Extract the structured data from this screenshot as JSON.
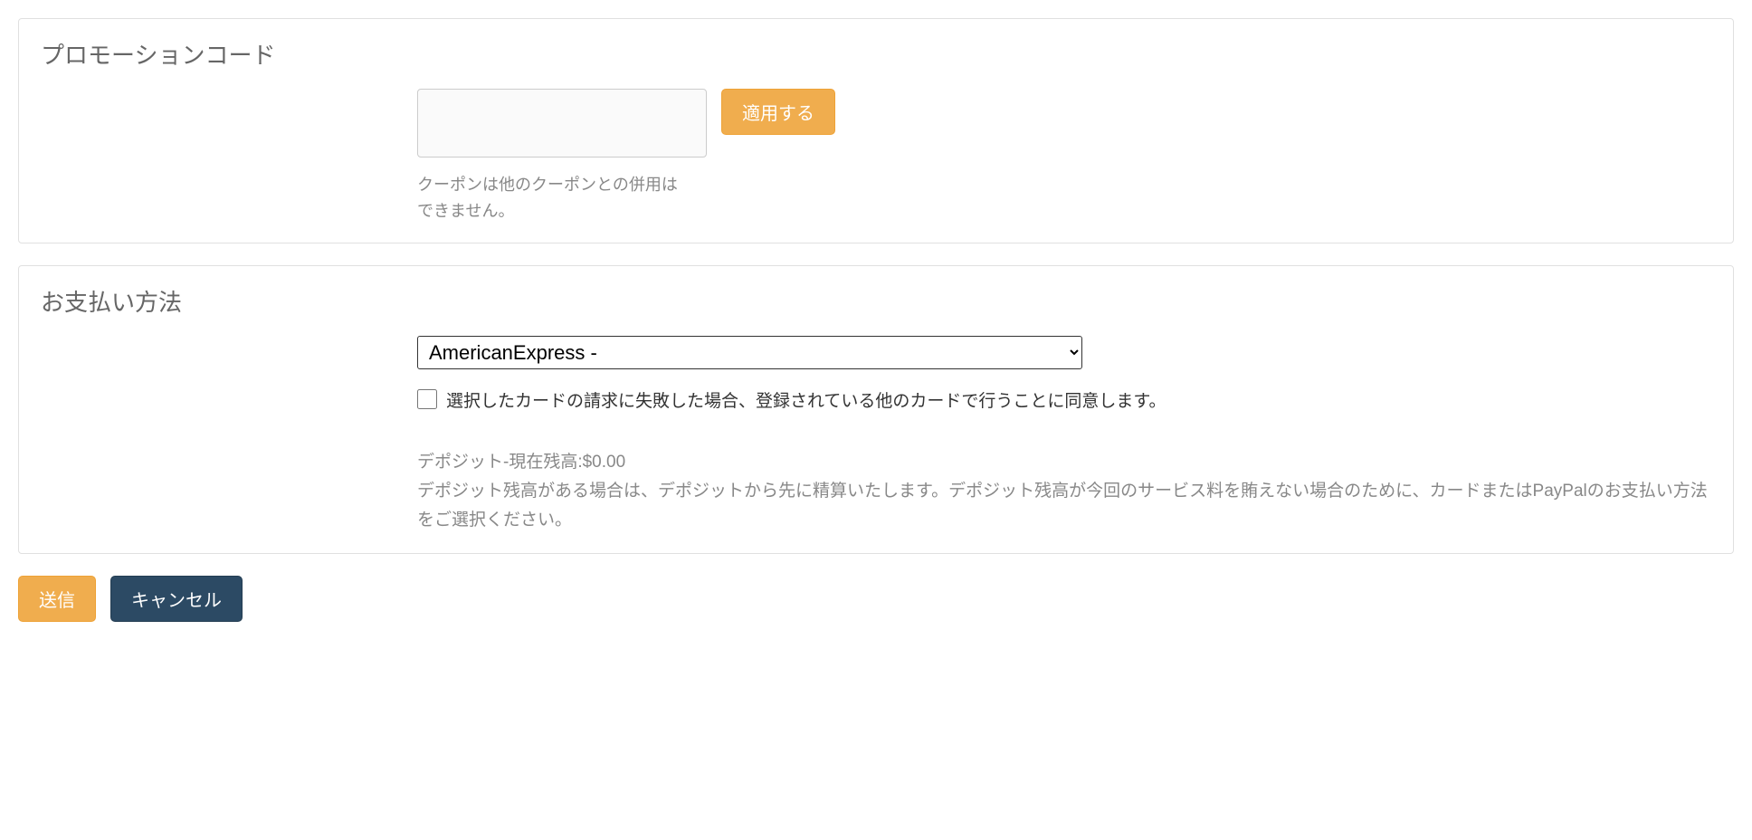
{
  "promo": {
    "title": "プロモーションコード",
    "input_value": "",
    "apply_label": "適用する",
    "help_line1": "クーポンは他のクーポンとの併用は",
    "help_line2": "できません。"
  },
  "payment": {
    "title": "お支払い方法",
    "select_value": "AmericanExpress -",
    "consent_label": "選択したカードの請求に失敗した場合、登録されている他のカードで行うことに同意します。",
    "deposit_balance": "デポジット-現在残高:$0.00",
    "deposit_note": "デポジット残高がある場合は、デポジットから先に精算いたします。デポジット残高が今回のサービス料を賄えない場合のために、カードまたはPayPalのお支払い方法をご選択ください。"
  },
  "actions": {
    "submit_label": "送信",
    "cancel_label": "キャンセル"
  }
}
